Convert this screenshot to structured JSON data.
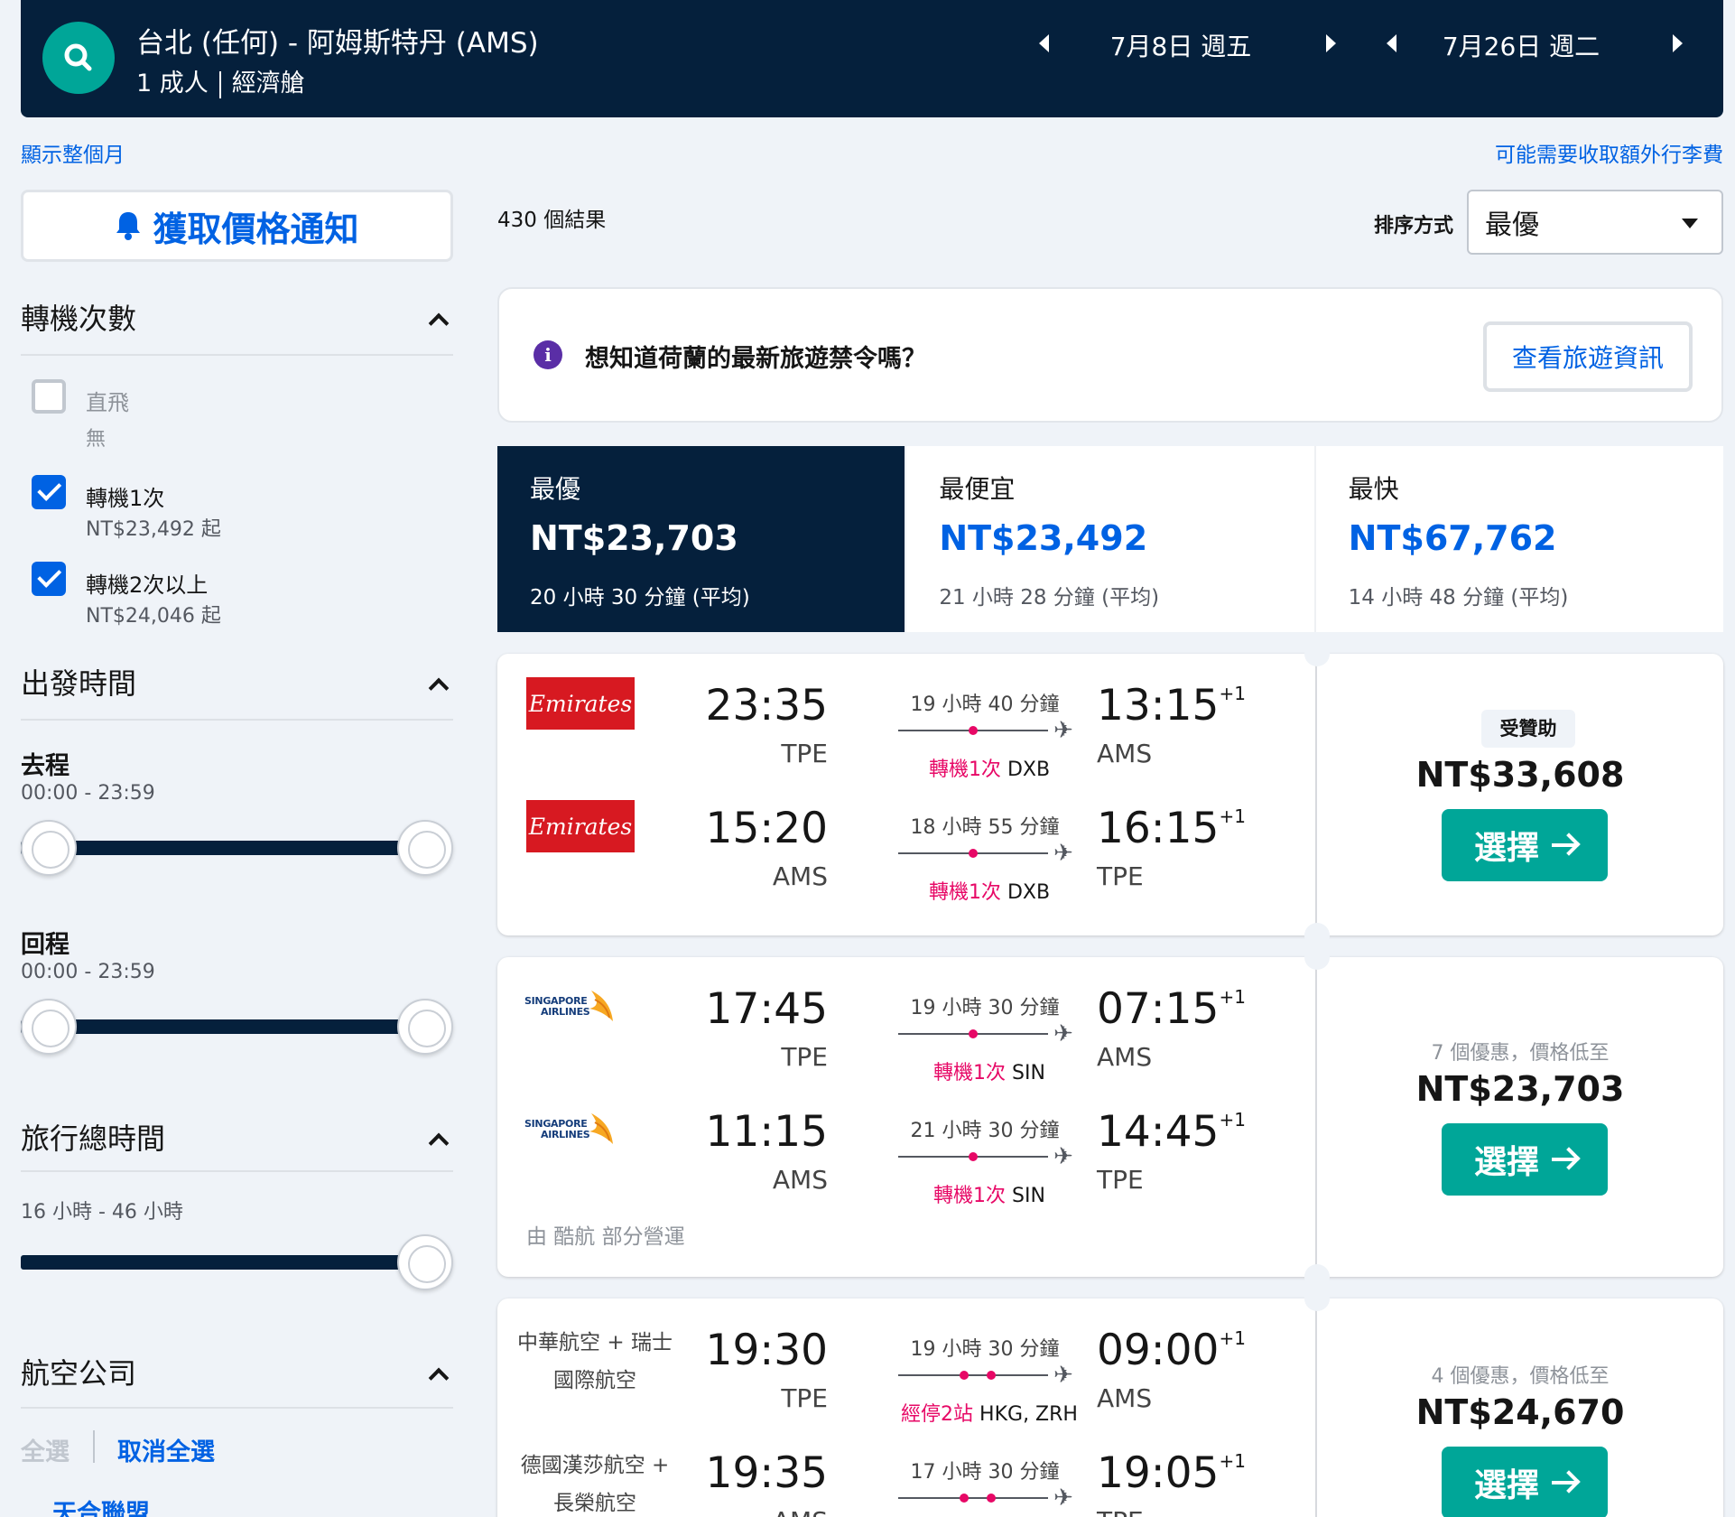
{
  "header": {
    "route": "台北 (任何) - 阿姆斯特丹 (AMS)",
    "adults": "1 成人",
    "cabin": "經濟艙",
    "depart_date": "7月8日 週五",
    "return_date": "7月26日 週二"
  },
  "links": {
    "show_month": "顯示整個月",
    "baggage_fee": "可能需要收取額外行李費"
  },
  "sidebar": {
    "price_alert": "獲取價格通知",
    "stops": {
      "title": "轉機次數",
      "options": [
        {
          "label": "直飛",
          "sub": "無",
          "checked": false
        },
        {
          "label": "轉機1次",
          "sub": "NT$23,492 起",
          "checked": true
        },
        {
          "label": "轉機2次以上",
          "sub": "NT$24,046 起",
          "checked": true
        }
      ]
    },
    "times": {
      "title": "出發時間",
      "outbound_label": "去程",
      "outbound_range": "00:00 - 23:59",
      "return_label": "回程",
      "return_range": "00:00 - 23:59"
    },
    "duration": {
      "title": "旅行總時間",
      "range": "16 小時 - 46 小時"
    },
    "airlines": {
      "title": "航空公司",
      "select_all": "全選",
      "deselect_all": "取消全選",
      "alliance_partial": "天合聯盟"
    }
  },
  "results": {
    "count": "430 個結果",
    "sort_label": "排序方式",
    "sort_value": "最優"
  },
  "info": {
    "icon": "i",
    "text": "想知道荷蘭的最新旅遊禁令嗎？",
    "button": "查看旅遊資訊"
  },
  "sort_tabs": [
    {
      "title": "最優",
      "price": "NT$23,703",
      "duration": "20 小時 30 分鐘 (平均)"
    },
    {
      "title": "最便宜",
      "price": "NT$23,492",
      "duration": "21 小時 28 分鐘 (平均)"
    },
    {
      "title": "最快",
      "price": "NT$67,762",
      "duration": "14 小時 48 分鐘 (平均)"
    }
  ],
  "cards": [
    {
      "legs": [
        {
          "airline": "Emirates",
          "dep_time": "23:35",
          "dep_code": "TPE",
          "duration": "19 小時 40 分鐘",
          "stops_label": "轉機1次",
          "stops_via": "DXB",
          "arr_time": "13:15",
          "arr_offset": "+1",
          "arr_code": "AMS"
        },
        {
          "airline": "Emirates",
          "dep_time": "15:20",
          "dep_code": "AMS",
          "duration": "18 小時 55 分鐘",
          "stops_label": "轉機1次",
          "stops_via": "DXB",
          "arr_time": "16:15",
          "arr_offset": "+1",
          "arr_code": "TPE"
        }
      ],
      "sponsored": "受贊助",
      "price": "NT$33,608",
      "select": "選擇"
    },
    {
      "legs": [
        {
          "airline_line1": "SINGAPORE",
          "airline_line2": "AIRLINES",
          "dep_time": "17:45",
          "dep_code": "TPE",
          "duration": "19 小時 30 分鐘",
          "stops_label": "轉機1次",
          "stops_via": "SIN",
          "arr_time": "07:15",
          "arr_offset": "+1",
          "arr_code": "AMS"
        },
        {
          "airline_line1": "SINGAPORE",
          "airline_line2": "AIRLINES",
          "dep_time": "11:15",
          "dep_code": "AMS",
          "duration": "21 小時 30 分鐘",
          "stops_label": "轉機1次",
          "stops_via": "SIN",
          "arr_time": "14:45",
          "arr_offset": "+1",
          "arr_code": "TPE"
        }
      ],
      "operated": "由 酷航 部分營運",
      "deals": "7 個優惠，價格低至",
      "price": "NT$23,703",
      "select": "選擇"
    },
    {
      "legs": [
        {
          "airline": "中華航空 + 瑞士國際航空",
          "dep_time": "19:30",
          "dep_code": "TPE",
          "duration": "19 小時 30 分鐘",
          "stops_label": "經停2站",
          "stops_via": "HKG, ZRH",
          "arr_time": "09:00",
          "arr_offset": "+1",
          "arr_code": "AMS"
        },
        {
          "airline": "德國漢莎航空 + 長榮航空",
          "dep_time": "19:35",
          "dep_code": "AMS",
          "duration": "17 小時 30 分鐘",
          "arr_time": "19:05",
          "arr_offset": "+1",
          "arr_code": "TPE"
        }
      ],
      "deals": "4 個優惠，價格低至",
      "price": "NT$24,670",
      "select": "選擇"
    }
  ],
  "colors": {
    "navy": "#05203c",
    "teal": "#00a698",
    "blue": "#0062e3",
    "stop_red": "#e70866"
  }
}
